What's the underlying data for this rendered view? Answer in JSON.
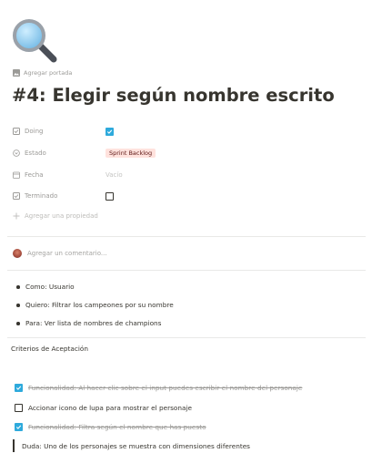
{
  "page": {
    "icon": "magnifying-glass-icon",
    "add_cover_label": "Agregar portada",
    "title": "#4: Elegir según nombre escrito"
  },
  "properties": [
    {
      "name": "Doing",
      "icon": "checkbox-icon",
      "type": "checkbox",
      "checked": true
    },
    {
      "name": "Estado",
      "icon": "select-icon",
      "type": "tag",
      "value": "Sprint Backlog",
      "color": "#ffe2dd"
    },
    {
      "name": "Fecha",
      "icon": "calendar-icon",
      "type": "date",
      "value": "Vacío"
    },
    {
      "name": "Terminado",
      "icon": "checkbox-icon",
      "type": "checkbox",
      "checked": false
    }
  ],
  "add_property_label": "Agregar una propiedad",
  "comment": {
    "placeholder": "Agregar un comentario..."
  },
  "bullets": [
    "Como: Usuario",
    "Quiero: Filtrar los campeones por su nombre",
    "Para: Ver lista de nombres de champions"
  ],
  "criteria_heading": "Criterios de Aceptación",
  "todos": [
    {
      "text": "Funcionalidad: Al hacer clic sobre el input puedes escribir el nombre del personaje",
      "checked": true
    },
    {
      "text": "Accionar icono de lupa para mostrar el personaje",
      "checked": false
    },
    {
      "text": "Funcionalidad: Filtra según el nombre que has puesto",
      "checked": true
    }
  ],
  "quote": "Duda: Uno de los personajes se muestra con dimensiones diferentes",
  "colors": {
    "accent": "#2eaadc",
    "text": "#37352f",
    "muted": "#9b9a97",
    "tag_bg": "#ffe2dd"
  }
}
